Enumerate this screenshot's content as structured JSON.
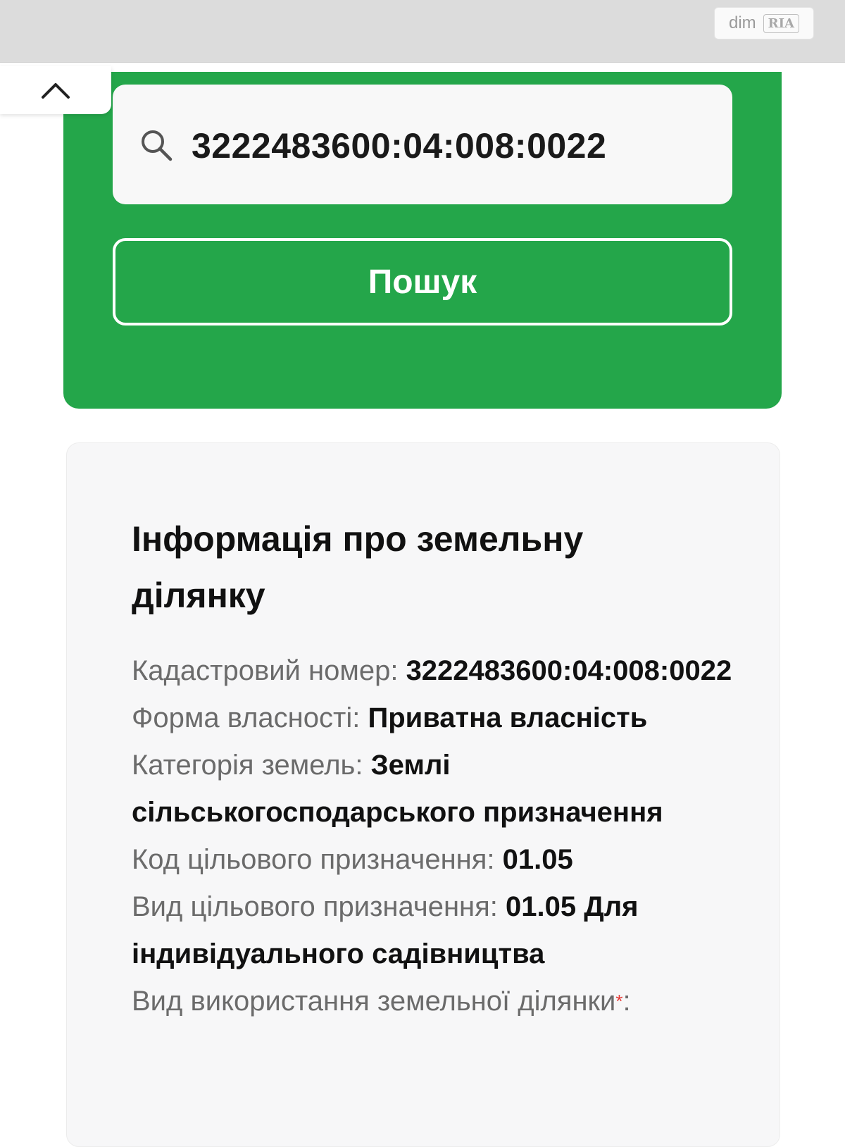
{
  "watermark": {
    "text": "dim",
    "badge": "RIA"
  },
  "search": {
    "value": "3222483600:04:008:0022",
    "button_label": "Пошук"
  },
  "info": {
    "title": "Інформація про земельну ділянку",
    "rows": [
      {
        "label": "Кадастровий номер: ",
        "value": "3222483600:04:008:0022"
      },
      {
        "label": "Форма власності: ",
        "value": "Приватна власність"
      },
      {
        "label": "Категорія земель: ",
        "value": "Землі сільськогосподарського призначення"
      },
      {
        "label": "Код цільового призначення: ",
        "value": "01.05"
      },
      {
        "label": "Вид цільового призначення: ",
        "value": "01.05 Для індивідуального садівництва"
      },
      {
        "label": "Вид використання земельної ділянки",
        "value": ":"
      }
    ]
  },
  "colors": {
    "accent_green": "#24a64a",
    "label_grey": "#6b6b6b"
  },
  "icons": {
    "collapse": "chevron-up-icon",
    "search": "search-icon"
  }
}
